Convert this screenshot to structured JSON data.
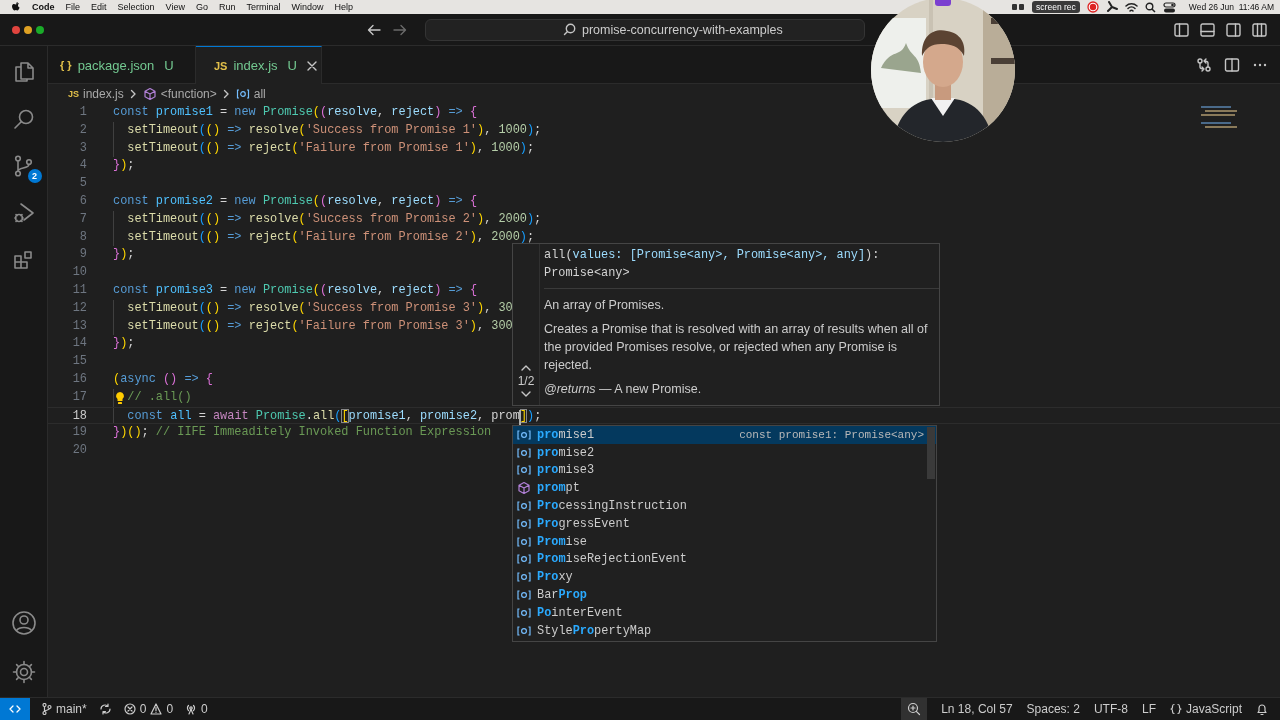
{
  "menu_bar": {
    "app": "Code",
    "items": [
      "File",
      "Edit",
      "Selection",
      "View",
      "Go",
      "Run",
      "Terminal",
      "Window",
      "Help"
    ],
    "recorder_badge": "screen rec",
    "clock": "Wed 26 Jun  11:46 AM"
  },
  "title_bar": {
    "command_center": "promise-concurrency-with-examples"
  },
  "activity_bar": {
    "source_control_badge": "2"
  },
  "tabs": [
    {
      "icon_text": "{ }",
      "label": "package.json",
      "status": "U",
      "selected": false
    },
    {
      "icon_text": "JS",
      "label": "index.js",
      "status": "U",
      "selected": true
    }
  ],
  "breadcrumbs": [
    {
      "kind": "file",
      "icon_text": "JS",
      "label": "index.js"
    },
    {
      "kind": "function",
      "label": "<function>"
    },
    {
      "kind": "variable",
      "label": "all"
    }
  ],
  "editor": {
    "lines": [
      {
        "number": "1",
        "active": false,
        "indented": false,
        "tokens": [
          {
            "kind": "kw",
            "text": "const "
          },
          {
            "kind": "var",
            "text": "promise1"
          },
          {
            "kind": "plain",
            "text": " = "
          },
          {
            "kind": "kw",
            "text": "new "
          },
          {
            "kind": "cls",
            "text": "Promise"
          },
          {
            "kind": "p1",
            "text": "("
          },
          {
            "kind": "p2",
            "text": "("
          },
          {
            "kind": "param",
            "text": "resolve"
          },
          {
            "kind": "plain",
            "text": ", "
          },
          {
            "kind": "param",
            "text": "reject"
          },
          {
            "kind": "p2",
            "text": ")"
          },
          {
            "kind": "kw",
            "text": " => "
          },
          {
            "kind": "p2",
            "text": "{"
          }
        ]
      },
      {
        "number": "2",
        "active": false,
        "indented": true,
        "tokens": [
          {
            "kind": "fn",
            "text": "setTimeout"
          },
          {
            "kind": "p3",
            "text": "("
          },
          {
            "kind": "p1",
            "text": "()"
          },
          {
            "kind": "kw",
            "text": " => "
          },
          {
            "kind": "fn",
            "text": "resolve"
          },
          {
            "kind": "p1",
            "text": "("
          },
          {
            "kind": "str",
            "text": "'Success from Promise 1'"
          },
          {
            "kind": "p1",
            "text": ")"
          },
          {
            "kind": "plain",
            "text": ", "
          },
          {
            "kind": "num",
            "text": "1000"
          },
          {
            "kind": "p3",
            "text": ")"
          },
          {
            "kind": "plain",
            "text": ";"
          }
        ]
      },
      {
        "number": "3",
        "active": false,
        "indented": true,
        "tokens": [
          {
            "kind": "fn",
            "text": "setTimeout"
          },
          {
            "kind": "p3",
            "text": "("
          },
          {
            "kind": "p1",
            "text": "()"
          },
          {
            "kind": "kw",
            "text": " => "
          },
          {
            "kind": "fn",
            "text": "reject"
          },
          {
            "kind": "p1",
            "text": "("
          },
          {
            "kind": "str",
            "text": "'Failure from Promise 1'"
          },
          {
            "kind": "p1",
            "text": ")"
          },
          {
            "kind": "plain",
            "text": ", "
          },
          {
            "kind": "num",
            "text": "1000"
          },
          {
            "kind": "p3",
            "text": ")"
          },
          {
            "kind": "plain",
            "text": ";"
          }
        ]
      },
      {
        "number": "4",
        "active": false,
        "indented": false,
        "tokens": [
          {
            "kind": "p2",
            "text": "}"
          },
          {
            "kind": "p1",
            "text": ")"
          },
          {
            "kind": "plain",
            "text": ";"
          }
        ]
      },
      {
        "number": "5",
        "active": false
      },
      {
        "number": "6",
        "active": false,
        "indented": false,
        "tokens": [
          {
            "kind": "kw",
            "text": "const "
          },
          {
            "kind": "var",
            "text": "promise2"
          },
          {
            "kind": "plain",
            "text": " = "
          },
          {
            "kind": "kw",
            "text": "new "
          },
          {
            "kind": "cls",
            "text": "Promise"
          },
          {
            "kind": "p1",
            "text": "("
          },
          {
            "kind": "p2",
            "text": "("
          },
          {
            "kind": "param",
            "text": "resolve"
          },
          {
            "kind": "plain",
            "text": ", "
          },
          {
            "kind": "param",
            "text": "reject"
          },
          {
            "kind": "p2",
            "text": ")"
          },
          {
            "kind": "kw",
            "text": " => "
          },
          {
            "kind": "p2",
            "text": "{"
          }
        ]
      },
      {
        "number": "7",
        "active": false,
        "indented": true,
        "tokens": [
          {
            "kind": "fn",
            "text": "setTimeout"
          },
          {
            "kind": "p3",
            "text": "("
          },
          {
            "kind": "p1",
            "text": "()"
          },
          {
            "kind": "kw",
            "text": " => "
          },
          {
            "kind": "fn",
            "text": "resolve"
          },
          {
            "kind": "p1",
            "text": "("
          },
          {
            "kind": "str",
            "text": "'Success from Promise 2'"
          },
          {
            "kind": "p1",
            "text": ")"
          },
          {
            "kind": "plain",
            "text": ", "
          },
          {
            "kind": "num",
            "text": "2000"
          },
          {
            "kind": "p3",
            "text": ")"
          },
          {
            "kind": "plain",
            "text": ";"
          }
        ]
      },
      {
        "number": "8",
        "active": false,
        "indented": true,
        "tokens": [
          {
            "kind": "fn",
            "text": "setTimeout"
          },
          {
            "kind": "p3",
            "text": "("
          },
          {
            "kind": "p1",
            "text": "()"
          },
          {
            "kind": "kw",
            "text": " => "
          },
          {
            "kind": "fn",
            "text": "reject"
          },
          {
            "kind": "p1",
            "text": "("
          },
          {
            "kind": "str",
            "text": "'Failure from Promise 2'"
          },
          {
            "kind": "p1",
            "text": ")"
          },
          {
            "kind": "plain",
            "text": ", "
          },
          {
            "kind": "num",
            "text": "2000"
          },
          {
            "kind": "p3",
            "text": ")"
          },
          {
            "kind": "plain",
            "text": ";"
          }
        ]
      },
      {
        "number": "9",
        "active": false,
        "indented": false,
        "tokens": [
          {
            "kind": "p2",
            "text": "}"
          },
          {
            "kind": "p1",
            "text": ")"
          },
          {
            "kind": "plain",
            "text": ";"
          }
        ]
      },
      {
        "number": "10",
        "active": false
      },
      {
        "number": "11",
        "active": false,
        "indented": false,
        "tokens": [
          {
            "kind": "kw",
            "text": "const "
          },
          {
            "kind": "var",
            "text": "promise3"
          },
          {
            "kind": "plain",
            "text": " = "
          },
          {
            "kind": "kw",
            "text": "new "
          },
          {
            "kind": "cls",
            "text": "Promise"
          },
          {
            "kind": "p1",
            "text": "("
          },
          {
            "kind": "p2",
            "text": "("
          },
          {
            "kind": "param",
            "text": "resolve"
          },
          {
            "kind": "plain",
            "text": ", "
          },
          {
            "kind": "param",
            "text": "reject"
          },
          {
            "kind": "p2",
            "text": ")"
          },
          {
            "kind": "kw",
            "text": " => "
          },
          {
            "kind": "p2",
            "text": "{"
          }
        ]
      },
      {
        "number": "12",
        "active": false,
        "indented": true,
        "tokens": [
          {
            "kind": "fn",
            "text": "setTimeout"
          },
          {
            "kind": "p3",
            "text": "("
          },
          {
            "kind": "p1",
            "text": "()"
          },
          {
            "kind": "kw",
            "text": " => "
          },
          {
            "kind": "fn",
            "text": "resolve"
          },
          {
            "kind": "p1",
            "text": "("
          },
          {
            "kind": "str",
            "text": "'Success from Promise 3'"
          },
          {
            "kind": "p1",
            "text": ")"
          },
          {
            "kind": "plain",
            "text": ", "
          },
          {
            "kind": "num",
            "text": "30"
          }
        ]
      },
      {
        "number": "13",
        "active": false,
        "indented": true,
        "tokens": [
          {
            "kind": "fn",
            "text": "setTimeout"
          },
          {
            "kind": "p3",
            "text": "("
          },
          {
            "kind": "p1",
            "text": "()"
          },
          {
            "kind": "kw",
            "text": " => "
          },
          {
            "kind": "fn",
            "text": "reject"
          },
          {
            "kind": "p1",
            "text": "("
          },
          {
            "kind": "str",
            "text": "'Failure from Promise 3'"
          },
          {
            "kind": "p1",
            "text": ")"
          },
          {
            "kind": "plain",
            "text": ", "
          },
          {
            "kind": "num",
            "text": "300"
          }
        ]
      },
      {
        "number": "14",
        "active": false,
        "indented": false,
        "tokens": [
          {
            "kind": "p2",
            "text": "}"
          },
          {
            "kind": "p1",
            "text": ")"
          },
          {
            "kind": "plain",
            "text": ";"
          }
        ]
      },
      {
        "number": "15",
        "active": false
      },
      {
        "number": "16",
        "active": false,
        "indented": false,
        "tokens": [
          {
            "kind": "p1",
            "text": "("
          },
          {
            "kind": "kw",
            "text": "async "
          },
          {
            "kind": "p2",
            "text": "()"
          },
          {
            "kind": "kw",
            "text": " => "
          },
          {
            "kind": "p2",
            "text": "{"
          }
        ]
      },
      {
        "number": "17",
        "active": false,
        "indented": true,
        "lightbulb": true,
        "tokens": [
          {
            "kind": "comment",
            "text": "// .all()"
          }
        ]
      },
      {
        "number": "18",
        "active": true,
        "indented": true,
        "tokens": [
          {
            "kind": "kw",
            "text": "const "
          },
          {
            "kind": "var",
            "text": "all"
          },
          {
            "kind": "plain",
            "text": " = "
          },
          {
            "kind": "await",
            "text": "await "
          },
          {
            "kind": "cls",
            "text": "Promise"
          },
          {
            "kind": "plain",
            "text": "."
          },
          {
            "kind": "fn",
            "text": "all"
          },
          {
            "kind": "p3",
            "text": "("
          },
          {
            "kind": "match",
            "text": "["
          },
          {
            "kind": "param",
            "text": "promise1"
          },
          {
            "kind": "plain",
            "text": ", "
          },
          {
            "kind": "param",
            "text": "promise2"
          },
          {
            "kind": "plain",
            "text": ", "
          },
          {
            "kind": "typed",
            "text": "prom"
          },
          {
            "kind": "match",
            "text": "]"
          },
          {
            "kind": "p3",
            "text": ")"
          },
          {
            "kind": "plain",
            "text": ";"
          }
        ]
      },
      {
        "number": "19",
        "active": false,
        "indented": false,
        "tokens": [
          {
            "kind": "p2",
            "text": "}"
          },
          {
            "kind": "p1",
            "text": ")()"
          },
          {
            "kind": "plain",
            "text": "; "
          },
          {
            "kind": "comment",
            "text": "// IIFE Immeaditely Invoked Function Expression"
          }
        ]
      },
      {
        "number": "20",
        "active": false
      }
    ]
  },
  "hover": {
    "counter": "1/2",
    "signature_lines": [
      [
        {
          "kind": "plain",
          "text": "all("
        },
        {
          "kind": "param",
          "text": "values: [Promise<any>, Promise<any>, any]"
        },
        {
          "kind": "plain",
          "text": "):"
        }
      ],
      [
        {
          "kind": "plain",
          "text": "Promise<any>"
        }
      ]
    ],
    "paragraphs": [
      "An array of Promises.",
      "Creates a Promise that is resolved with an array of results when all of the provided Promises resolve, or rejected when any Promise is rejected.",
      "*@returns* — A new Promise."
    ]
  },
  "suggestions": [
    {
      "kind": "variable",
      "selected": true,
      "parts": [
        {
          "text": "pro",
          "match": true
        },
        {
          "text": "mise1",
          "match": false
        }
      ],
      "detail": "const promise1: Promise<any>"
    },
    {
      "kind": "variable",
      "selected": false,
      "parts": [
        {
          "text": "pro",
          "match": true
        },
        {
          "text": "mise2",
          "match": false
        }
      ]
    },
    {
      "kind": "variable",
      "selected": false,
      "parts": [
        {
          "text": "pro",
          "match": true
        },
        {
          "text": "mise3",
          "match": false
        }
      ]
    },
    {
      "kind": "module",
      "selected": false,
      "parts": [
        {
          "text": "prom",
          "match": true
        },
        {
          "text": "pt",
          "match": false
        }
      ]
    },
    {
      "kind": "variable",
      "selected": false,
      "parts": [
        {
          "text": "Pro",
          "match": true
        },
        {
          "text": "cessingInstruction",
          "match": false
        }
      ]
    },
    {
      "kind": "variable",
      "selected": false,
      "parts": [
        {
          "text": "Pro",
          "match": true
        },
        {
          "text": "gressEvent",
          "match": false
        }
      ]
    },
    {
      "kind": "variable",
      "selected": false,
      "parts": [
        {
          "text": "Prom",
          "match": true
        },
        {
          "text": "ise",
          "match": false
        }
      ]
    },
    {
      "kind": "variable",
      "selected": false,
      "parts": [
        {
          "text": "Prom",
          "match": true
        },
        {
          "text": "iseRejectionEvent",
          "match": false
        }
      ]
    },
    {
      "kind": "variable",
      "selected": false,
      "parts": [
        {
          "text": "Pro",
          "match": true
        },
        {
          "text": "xy",
          "match": false
        }
      ]
    },
    {
      "kind": "variable",
      "selected": false,
      "parts": [
        {
          "text": "Bar",
          "match": false
        },
        {
          "text": "Prop",
          "match": true
        }
      ]
    },
    {
      "kind": "variable",
      "selected": false,
      "parts": [
        {
          "text": "Po",
          "match": true
        },
        {
          "text": "interEvent",
          "match": false
        }
      ]
    },
    {
      "kind": "variable",
      "selected": false,
      "parts": [
        {
          "text": "Style",
          "match": false
        },
        {
          "text": "Pro",
          "match": true
        },
        {
          "text": "pertyMap",
          "match": false
        }
      ]
    }
  ],
  "status_bar": {
    "branch": "main*",
    "errors": "0",
    "warnings": "0",
    "ports": "0",
    "cursor": "Ln 18, Col 57",
    "indent": "Spaces: 2",
    "encoding": "UTF-8",
    "eol": "LF",
    "language": "JavaScript"
  }
}
